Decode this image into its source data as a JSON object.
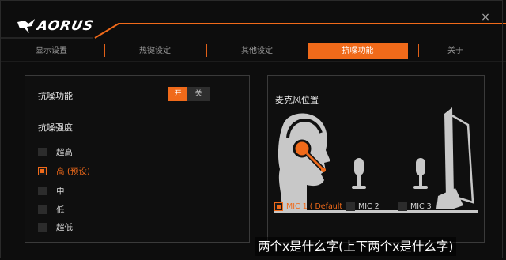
{
  "header": {
    "logo_text": "AORUS",
    "close_glyph": "×"
  },
  "tabs": [
    {
      "label": "显示设置",
      "active": false
    },
    {
      "label": "热键设定",
      "active": false
    },
    {
      "label": "其他设定",
      "active": false
    },
    {
      "label": "抗噪功能",
      "active": true
    },
    {
      "label": "关于",
      "active": false
    }
  ],
  "left_panel": {
    "feature_label": "抗噪功能",
    "toggle_on": "开",
    "toggle_off": "关",
    "strength_label": "抗噪强度",
    "options": [
      {
        "label": "超高",
        "selected": false
      },
      {
        "label": "高 (预设)",
        "selected": true
      },
      {
        "label": "中",
        "selected": false
      },
      {
        "label": "低",
        "selected": false
      },
      {
        "label": "超低",
        "selected": false
      }
    ]
  },
  "right_panel": {
    "title": "麦克风位置",
    "mic_options": [
      {
        "label": "MIC 1 ( Default",
        "selected": true
      },
      {
        "label": "MIC 2",
        "selected": false
      },
      {
        "label": "MIC 3",
        "selected": false
      }
    ]
  },
  "caption": "两个x是什么字(上下两个x是什么字)",
  "colors": {
    "accent": "#f06a1a",
    "background": "#0d0d0d",
    "panel_border": "#3a3a3a",
    "illustration": "#c8c8c8"
  }
}
